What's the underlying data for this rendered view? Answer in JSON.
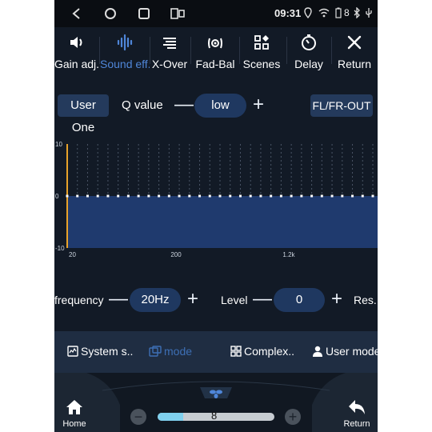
{
  "status_bar": {
    "time": "09:31",
    "battery_level": "8",
    "icons": [
      "back-icon",
      "home-icon",
      "recents-icon",
      "split-screen-icon",
      "location-icon",
      "wifi-icon",
      "battery-icon",
      "bluetooth-icon",
      "usb-icon"
    ]
  },
  "toolbar": {
    "items": [
      {
        "label": "Gain adj..",
        "icon": "speaker-icon"
      },
      {
        "label": "Sound eff..",
        "icon": "sound-wave-icon",
        "active": true
      },
      {
        "label": "X-Over",
        "icon": "crossover-icon"
      },
      {
        "label": "Fad-Bal",
        "icon": "fader-balance-icon"
      },
      {
        "label": "Scenes",
        "icon": "scenes-icon"
      },
      {
        "label": "Delay",
        "icon": "delay-icon"
      },
      {
        "label": "Return",
        "icon": "close-icon"
      }
    ]
  },
  "controls": {
    "preset": "User One",
    "q_label": "Q value",
    "q_value": "low",
    "channel": "FL/FR-OUT",
    "frequency_label": "frequency",
    "frequency_value": "20Hz",
    "level_label": "Level",
    "level_value": "0",
    "reset_label": "Res.."
  },
  "chart_data": {
    "type": "bar",
    "ylim": [
      -10,
      10
    ],
    "y_ticks": [
      "10",
      "0",
      "-10"
    ],
    "x_tick_labels": [
      "20",
      "200",
      "1.2k"
    ],
    "band_count": 31,
    "values": [
      0,
      0,
      0,
      0,
      0,
      0,
      0,
      0,
      0,
      0,
      0,
      0,
      0,
      0,
      0,
      0,
      0,
      0,
      0,
      0,
      0,
      0,
      0,
      0,
      0,
      0,
      0,
      0,
      0,
      0,
      0
    ],
    "selected_band": 0,
    "colors": {
      "fill": "#1f3a6e",
      "selected": "#e8a22a",
      "grid": "#4a5566"
    }
  },
  "mode_bar": {
    "items": [
      {
        "label": "System s..",
        "icon": "chart-icon"
      },
      {
        "label": "mode",
        "icon": "mode-icon",
        "active": true
      },
      {
        "label": "Complex..",
        "icon": "grid-icon"
      },
      {
        "label": "User mode",
        "icon": "user-icon"
      }
    ]
  },
  "dock": {
    "home_label": "Home",
    "return_label": "Return",
    "volume_value": "8",
    "volume_fraction": 0.22,
    "fan_icon": "fan-icon"
  },
  "colors": {
    "accent": "#4f86d8",
    "background": "#121a26",
    "pill": "#243a5c"
  }
}
